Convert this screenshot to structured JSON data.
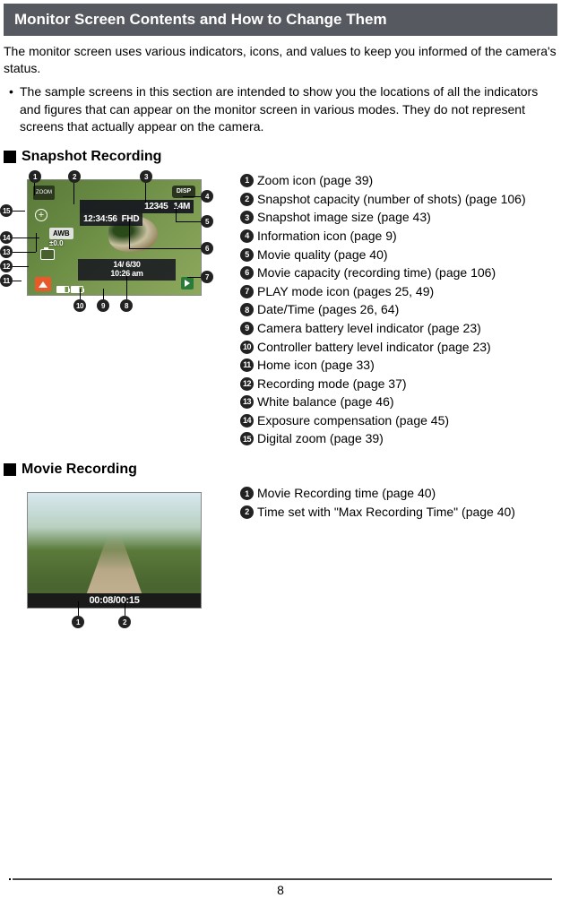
{
  "banner_title": "Monitor Screen Contents and How to Change Them",
  "intro_text": "The monitor screen uses various indicators, icons, and values to keep you informed of the camera's status.",
  "bullet_text": "The sample screens in this section are intended to show you the locations of all the indicators and figures that can appear on the monitor screen in various modes. They do not represent screens that actually appear on the camera.",
  "section1_title": "Snapshot Recording",
  "section2_title": "Movie Recording",
  "fig1": {
    "zoom_label": "ZOOM",
    "disp": "DISP",
    "counter": "12345",
    "size": "14M",
    "quality": "FHD",
    "tod": "12:34:56",
    "date": "14/  6/30",
    "clock": "10:26 am",
    "awb": "AWB",
    "ev": "±0.0"
  },
  "fig2": {
    "timecode": "00:08/00:15"
  },
  "defs1": [
    {
      "n": "1",
      "text": "Zoom icon (page 39)"
    },
    {
      "n": "2",
      "text": "Snapshot capacity (number of shots) (page 106)"
    },
    {
      "n": "3",
      "text": "Snapshot image size (page 43)"
    },
    {
      "n": "4",
      "text": "Information icon (page 9)"
    },
    {
      "n": "5",
      "text": "Movie quality (page 40)"
    },
    {
      "n": "6",
      "text": "Movie capacity (recording time) (page 106)"
    },
    {
      "n": "7",
      "text": "PLAY mode icon (pages 25, 49)"
    },
    {
      "n": "8",
      "text": "Date/Time (pages 26, 64)"
    },
    {
      "n": "9",
      "text": "Camera battery level indicator (page 23)"
    },
    {
      "n": "10",
      "text": "Controller battery level indicator (page 23)"
    },
    {
      "n": "11",
      "text": "Home icon (page 33)"
    },
    {
      "n": "12",
      "text": "Recording mode (page 37)"
    },
    {
      "n": "13",
      "text": "White balance (page 46)"
    },
    {
      "n": "14",
      "text": "Exposure compensation (page 45)"
    },
    {
      "n": "15",
      "text": "Digital zoom (page 39)"
    }
  ],
  "defs2": [
    {
      "n": "1",
      "text": "Movie Recording time (page 40)"
    },
    {
      "n": "2",
      "text": "Time set with \"Max Recording Time\" (page 40)"
    }
  ],
  "page_number": "8"
}
